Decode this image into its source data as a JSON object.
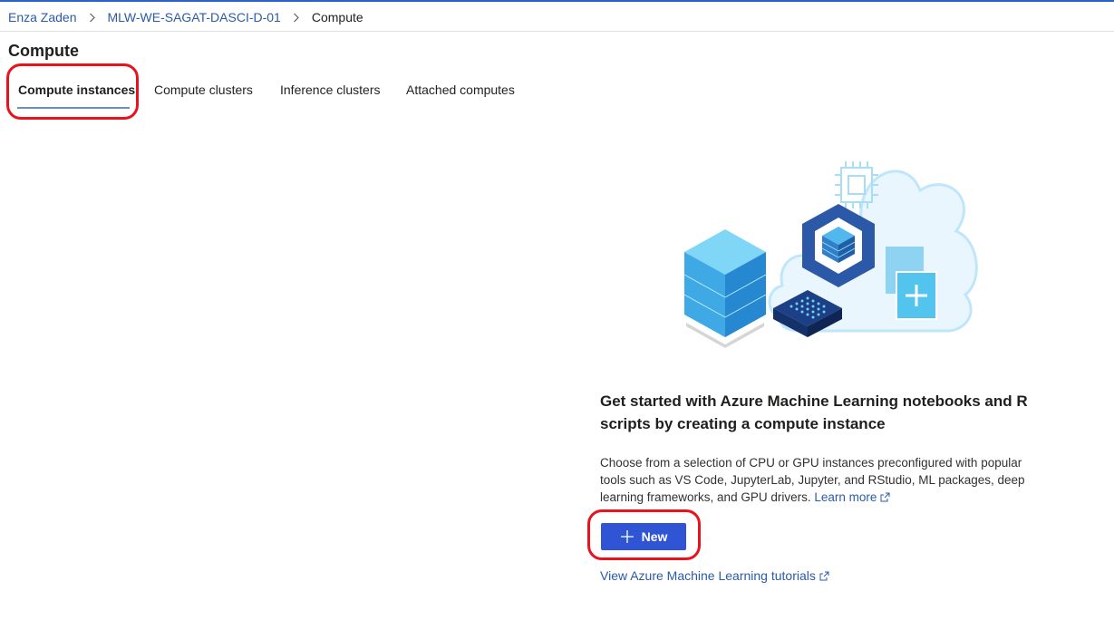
{
  "breadcrumb": {
    "items": [
      {
        "label": "Enza Zaden"
      },
      {
        "label": "MLW-WE-SAGAT-DASCI-D-01"
      },
      {
        "label": "Compute"
      }
    ]
  },
  "page": {
    "title": "Compute"
  },
  "tabs": [
    {
      "label": "Compute instances",
      "active": true
    },
    {
      "label": "Compute clusters",
      "active": false
    },
    {
      "label": "Inference clusters",
      "active": false
    },
    {
      "label": "Attached computes",
      "active": false
    }
  ],
  "empty_state": {
    "heading": "Get started with Azure Machine Learning notebooks and R scripts by creating a compute instance",
    "description": "Choose from a selection of CPU or GPU instances preconfigured with popular tools such as VS Code, JupyterLab, Jupyter, and RStudio, ML packages, deep learning frameworks, and GPU drivers.",
    "learn_more_label": "Learn more",
    "new_button_label": "New",
    "tutorials_link_label": "View Azure Machine Learning tutorials"
  },
  "icons": {
    "breadcrumb_separator": "chevron-right-icon",
    "external_link": "external-link-icon",
    "new": "plus-icon"
  },
  "colors": {
    "accent": "#2f55d4",
    "link": "#2b5aa8",
    "annotation": "#e8131e"
  }
}
